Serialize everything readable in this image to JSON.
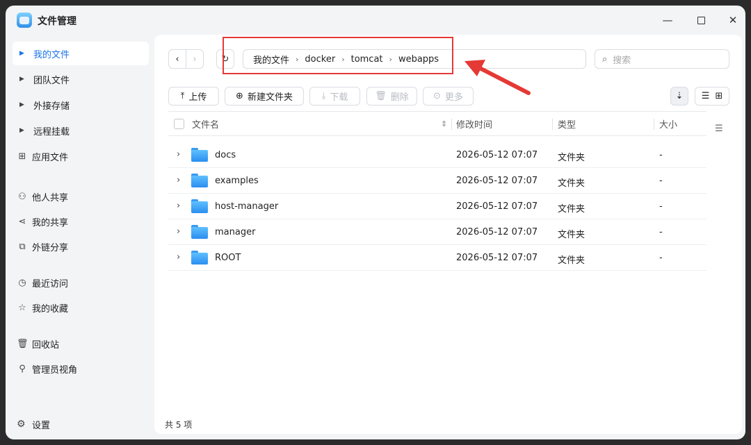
{
  "window": {
    "title": "文件管理"
  },
  "sidebar": {
    "items": [
      {
        "label": "我的文件",
        "active": true,
        "kind": "caret"
      },
      {
        "label": "团队文件",
        "kind": "caret"
      },
      {
        "label": "外接存储",
        "kind": "caret"
      },
      {
        "label": "远程挂载",
        "kind": "caret"
      },
      {
        "label": "应用文件",
        "kind": "icon",
        "icon": "apps-grid-icon"
      },
      {
        "label": "他人共享",
        "kind": "icon",
        "icon": "users-icon"
      },
      {
        "label": "我的共享",
        "kind": "icon",
        "icon": "share-icon"
      },
      {
        "label": "外链分享",
        "kind": "icon",
        "icon": "external-link-icon"
      },
      {
        "label": "最近访问",
        "kind": "icon",
        "icon": "clock-icon"
      },
      {
        "label": "我的收藏",
        "kind": "icon",
        "icon": "star-icon"
      },
      {
        "label": "回收站",
        "kind": "icon",
        "icon": "trash-icon"
      },
      {
        "label": "管理员视角",
        "kind": "icon",
        "icon": "admin-user-icon"
      }
    ],
    "settings_label": "设置"
  },
  "breadcrumb": [
    "我的文件",
    "docker",
    "tomcat",
    "webapps"
  ],
  "search": {
    "placeholder": "搜索"
  },
  "toolbar": {
    "upload": "上传",
    "new_folder": "新建文件夹",
    "download": "下载",
    "delete": "删除",
    "more": "更多"
  },
  "table": {
    "headers": {
      "name": "文件名",
      "mtime": "修改时间",
      "type": "类型",
      "size": "大小"
    },
    "rows": [
      {
        "name": "docs",
        "mtime": "2026-05-12 07:07",
        "type": "文件夹",
        "size": "-"
      },
      {
        "name": "examples",
        "mtime": "2026-05-12 07:07",
        "type": "文件夹",
        "size": "-"
      },
      {
        "name": "host-manager",
        "mtime": "2026-05-12 07:07",
        "type": "文件夹",
        "size": "-"
      },
      {
        "name": "manager",
        "mtime": "2026-05-12 07:07",
        "type": "文件夹",
        "size": "-"
      },
      {
        "name": "ROOT",
        "mtime": "2026-05-12 07:07",
        "type": "文件夹",
        "size": "-"
      }
    ]
  },
  "footer": {
    "count": "共 5 项"
  },
  "colors": {
    "accent": "#1a73e8",
    "annotation": "#e53935",
    "folder": "#2a8ef0"
  }
}
